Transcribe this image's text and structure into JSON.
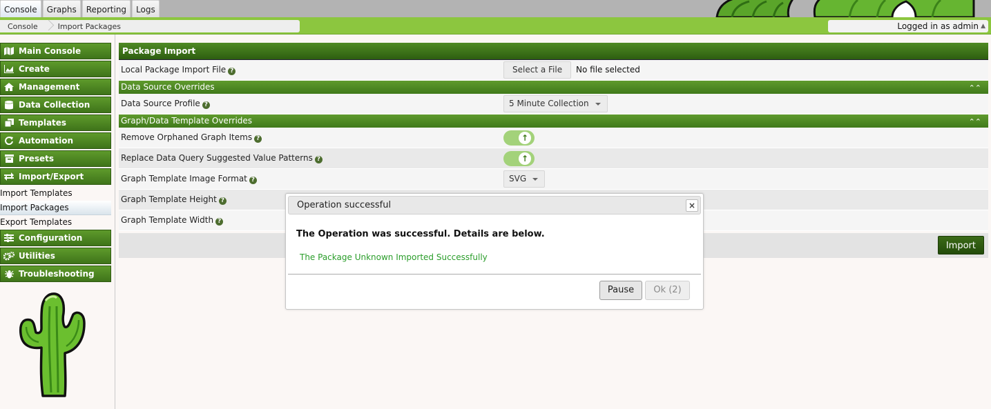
{
  "top_tabs": [
    {
      "label": "Console",
      "active": true
    },
    {
      "label": "Graphs",
      "active": false
    },
    {
      "label": "Reporting",
      "active": false
    },
    {
      "label": "Logs",
      "active": false
    }
  ],
  "breadcrumb": [
    "Console",
    "Import Packages"
  ],
  "user": {
    "label": "Logged in as admin",
    "caret": "▲"
  },
  "sidebar": {
    "items": [
      {
        "label": "Main Console",
        "icon": "map-icon"
      },
      {
        "label": "Create",
        "icon": "chart-icon"
      },
      {
        "label": "Management",
        "icon": "home-icon"
      },
      {
        "label": "Data Collection",
        "icon": "database-icon"
      },
      {
        "label": "Templates",
        "icon": "copy-icon"
      },
      {
        "label": "Automation",
        "icon": "refresh-icon"
      },
      {
        "label": "Presets",
        "icon": "archive-icon"
      },
      {
        "label": "Import/Export",
        "icon": "exchange-icon"
      }
    ],
    "sub_items": [
      {
        "label": "Import Templates",
        "active": false
      },
      {
        "label": "Import Packages",
        "active": true
      },
      {
        "label": "Export Templates",
        "active": false
      }
    ],
    "items_after": [
      {
        "label": "Configuration",
        "icon": "sliders-icon"
      },
      {
        "label": "Utilities",
        "icon": "cogs-icon"
      },
      {
        "label": "Troubleshooting",
        "icon": "bug-icon"
      }
    ]
  },
  "main": {
    "title": "Package Import",
    "local_file": {
      "label": "Local Package Import File",
      "button": "Select a File",
      "status": "No file selected"
    },
    "ds_overrides": {
      "title": "Data Source Overrides",
      "profile_label": "Data Source Profile",
      "profile_value": "5 Minute Collection"
    },
    "gt_overrides": {
      "title": "Graph/Data Template Overrides",
      "remove_orphaned_label": "Remove Orphaned Graph Items",
      "replace_patterns_label": "Replace Data Query Suggested Value Patterns",
      "image_format_label": "Graph Template Image Format",
      "image_format_value": "SVG",
      "height_label": "Graph Template Height",
      "width_label": "Graph Template Width"
    },
    "import_button": "Import"
  },
  "dialog": {
    "title": "Operation successful",
    "close": "×",
    "message": "The Operation was successful. Details are below.",
    "detail": "The Package Unknown Imported Successfully",
    "pause_button": "Pause",
    "ok_button": "Ok (2)"
  },
  "colors": {
    "accent_green": "#8cc63f",
    "menu_green": "#3f741a",
    "success_text": "#2a9d2a"
  }
}
